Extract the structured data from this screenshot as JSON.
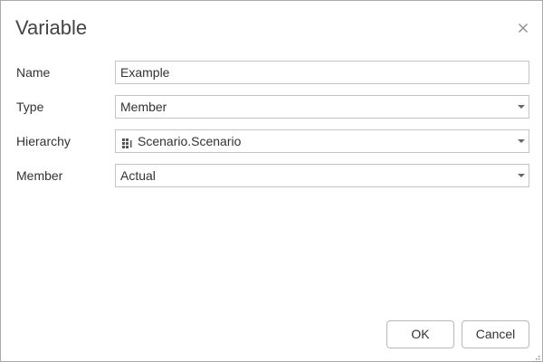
{
  "dialog": {
    "title": "Variable",
    "close_icon": "close-icon"
  },
  "fields": {
    "name": {
      "label": "Name",
      "value": "Example"
    },
    "type": {
      "label": "Type",
      "value": "Member"
    },
    "hierarchy": {
      "label": "Hierarchy",
      "value": "Scenario.Scenario",
      "icon": "hierarchy-icon"
    },
    "member": {
      "label": "Member",
      "value": "Actual"
    }
  },
  "buttons": {
    "ok": "OK",
    "cancel": "Cancel"
  },
  "icons": {
    "dropdown": "chevron-down-icon",
    "resize": "resize-grip-icon"
  }
}
